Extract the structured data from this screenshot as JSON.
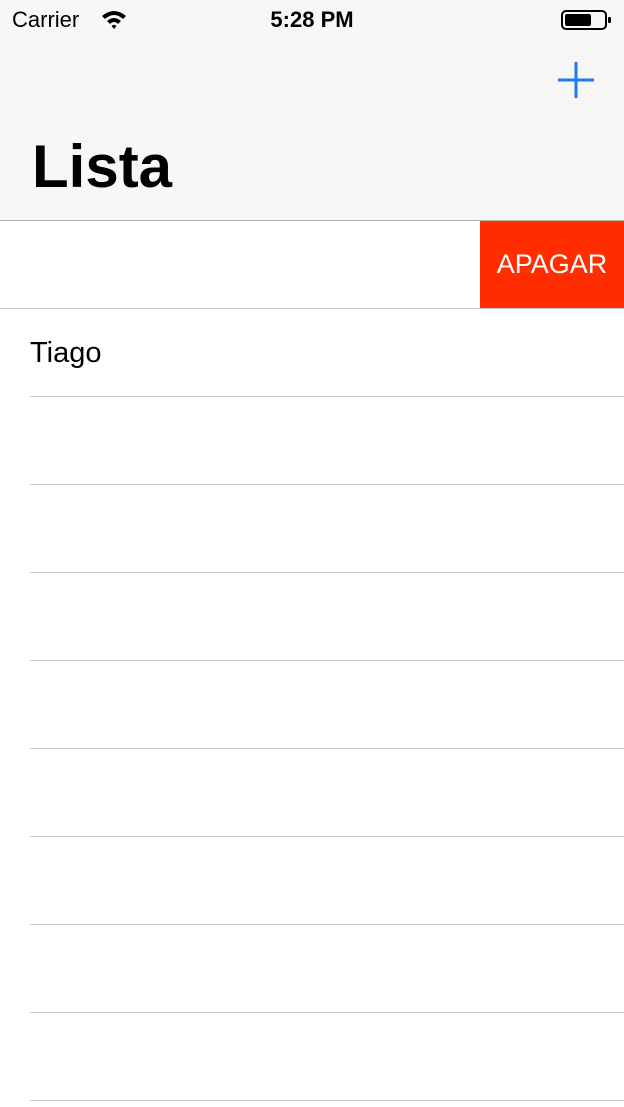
{
  "status_bar": {
    "carrier": "Carrier",
    "time": "5:28 PM",
    "wifi_icon": "wifi-icon",
    "battery_icon": "battery-icon"
  },
  "nav_bar": {
    "title": "Lista",
    "add_icon": "plus-icon",
    "accent_color": "#1a7cf3"
  },
  "list": {
    "swiped_row": {
      "label": "",
      "delete_label": "APAGAR",
      "delete_color": "#ff2d00"
    },
    "rows": [
      {
        "label": "Tiago"
      },
      {
        "label": ""
      },
      {
        "label": ""
      },
      {
        "label": ""
      },
      {
        "label": ""
      },
      {
        "label": ""
      },
      {
        "label": ""
      },
      {
        "label": ""
      },
      {
        "label": ""
      }
    ]
  }
}
